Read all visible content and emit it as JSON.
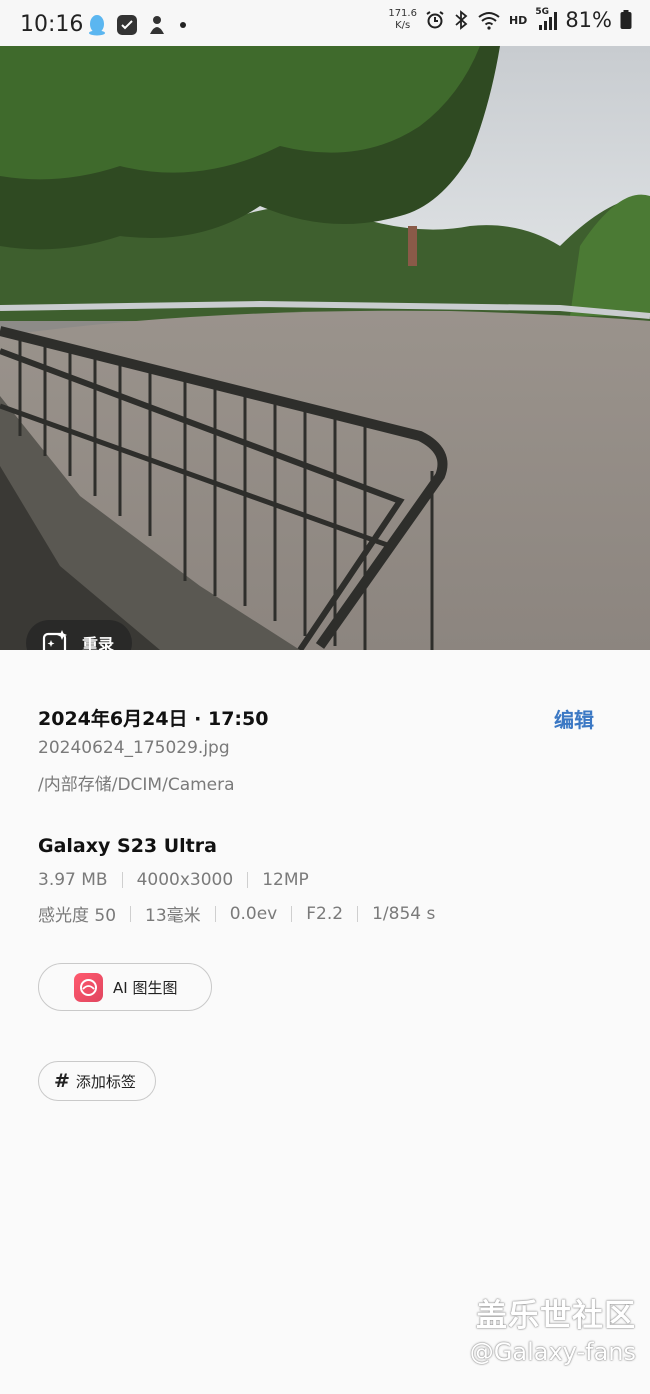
{
  "status_bar": {
    "time": "10:16",
    "speed_value": "171.6",
    "speed_unit": "K/s",
    "hd": "HD",
    "network": "5G",
    "battery": "81%",
    "icons": [
      "qq-icon",
      "app-icon",
      "notification-icon",
      "alarm-icon",
      "bluetooth-icon",
      "wifi-icon",
      "signal-icon",
      "battery-icon"
    ]
  },
  "photo": {
    "remaster_label": "重录"
  },
  "details": {
    "date_title": "2024年6月24日 · 17:50",
    "edit_label": "编辑",
    "file_name": "20240624_175029.jpg",
    "file_path": "/内部存储/DCIM/Camera",
    "device": "Galaxy S23 Ultra",
    "row1": [
      "3.97 MB",
      "4000x3000",
      "12MP"
    ],
    "row2": [
      "感光度 50",
      "13毫米",
      "0.0ev",
      "F2.2",
      "1/854 s"
    ],
    "ai_label": "AI 图生图",
    "tag_label": "添加标签"
  },
  "watermark": {
    "line1": "盖乐世社区",
    "line2": "@Galaxy-fans"
  },
  "colors": {
    "accent": "#3b78c4",
    "secondary_text": "#7a7a7a",
    "background": "#fafafa"
  }
}
